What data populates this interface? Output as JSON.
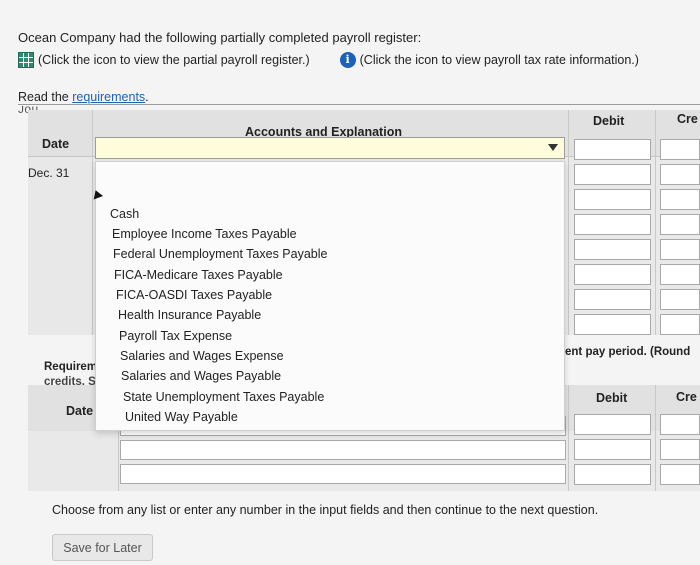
{
  "intro": {
    "text": "Ocean Company had the following partially completed payroll register:",
    "register_link": "(Click the icon to view the partial payroll register.)",
    "tax_link": "(Click the icon to view payroll tax rate information.)",
    "read_prefix": "Read the ",
    "requirements_link": "requirements",
    "read_suffix": "."
  },
  "clipped_text": "Jou... ...",
  "journal1": {
    "date_header": "Date",
    "account_header": "Accounts and Explanation",
    "debit_header": "Debit",
    "credit_header": "Cre",
    "date_value": "Dec. 31"
  },
  "dropdown": {
    "options": [
      "Cash",
      "Employee Income Taxes Payable",
      "Federal Unemployment Taxes Payable",
      "FICA-Medicare Taxes Payable",
      "FICA-OASDI Taxes Payable",
      "Health Insurance Payable",
      "Payroll Tax Expense",
      "Salaries and Wages Expense",
      "Salaries and Wages Payable",
      "State Unemployment Taxes Payable",
      "United Way Payable"
    ]
  },
  "requirement_partial": {
    "line1": "Requiremen",
    "line2": "credits. Selec",
    "right": "ent pay period. (Round"
  },
  "journal2": {
    "date_header": "Date",
    "debit_header": "Debit",
    "credit_header": "Cre"
  },
  "footer": {
    "instruction": "Choose from any list or enter any number in the input fields and then continue to the next question.",
    "save_label": "Save for Later"
  }
}
